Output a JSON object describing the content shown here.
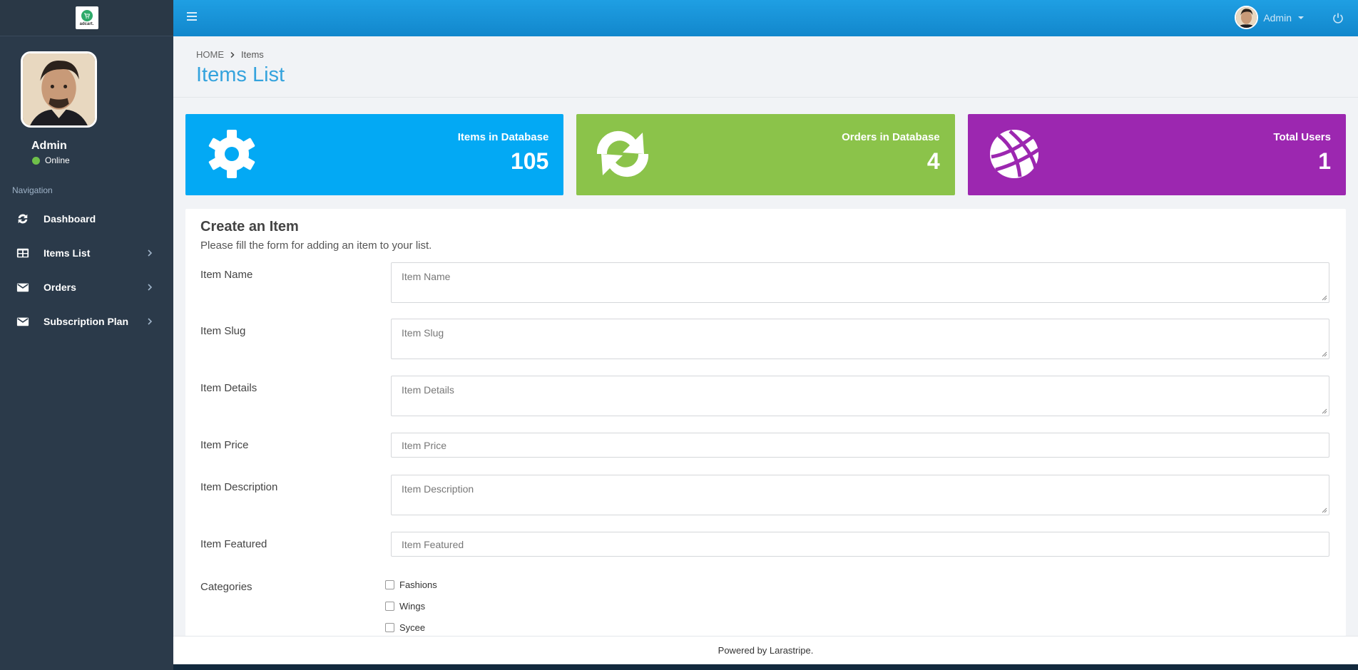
{
  "brand": {
    "logo_text": "adcart."
  },
  "profile": {
    "name": "Admin",
    "status": "Online"
  },
  "nav": {
    "header": "Navigation",
    "items": [
      {
        "label": "Dashboard",
        "icon": "refresh-icon"
      },
      {
        "label": "Items List",
        "icon": "table-icon"
      },
      {
        "label": "Orders",
        "icon": "envelope-icon"
      },
      {
        "label": "Subscription Plan",
        "icon": "envelope-icon"
      }
    ]
  },
  "topbar": {
    "user_name": "Admin"
  },
  "breadcrumb": {
    "home": "HOME",
    "current": "Items"
  },
  "page": {
    "title": "Items List"
  },
  "stats": [
    {
      "label": "Items in Database",
      "value": "105",
      "color": "#03a9f4",
      "icon": "gear-icon"
    },
    {
      "label": "Orders in Database",
      "value": "4",
      "color": "#8bc34a",
      "icon": "refresh-icon"
    },
    {
      "label": "Total Users",
      "value": "1",
      "color": "#9c27b0",
      "icon": "globe-icon"
    }
  ],
  "form": {
    "title": "Create an Item",
    "subtitle": "Please fill the form for adding an item to your list.",
    "fields": [
      {
        "label": "Item Name",
        "placeholder": "Item Name",
        "value": ""
      },
      {
        "label": "Item Slug",
        "placeholder": "Item Slug",
        "value": ""
      },
      {
        "label": "Item Details",
        "placeholder": "Item Details",
        "value": ""
      },
      {
        "label": "Item Price",
        "placeholder": "Item Price",
        "value": ""
      },
      {
        "label": "Item Description",
        "placeholder": "Item Description",
        "value": ""
      },
      {
        "label": "Item Featured",
        "placeholder": "Item Featured",
        "value": ""
      }
    ],
    "categories_label": "Categories",
    "categories": [
      "Fashions",
      "Wings",
      "Sycee"
    ]
  },
  "footer": {
    "text": "Powered by Larastripe."
  },
  "colors": {
    "topbar": "#1a96dc",
    "sidebar": "#2b3a4a",
    "title": "#35a3dd"
  }
}
